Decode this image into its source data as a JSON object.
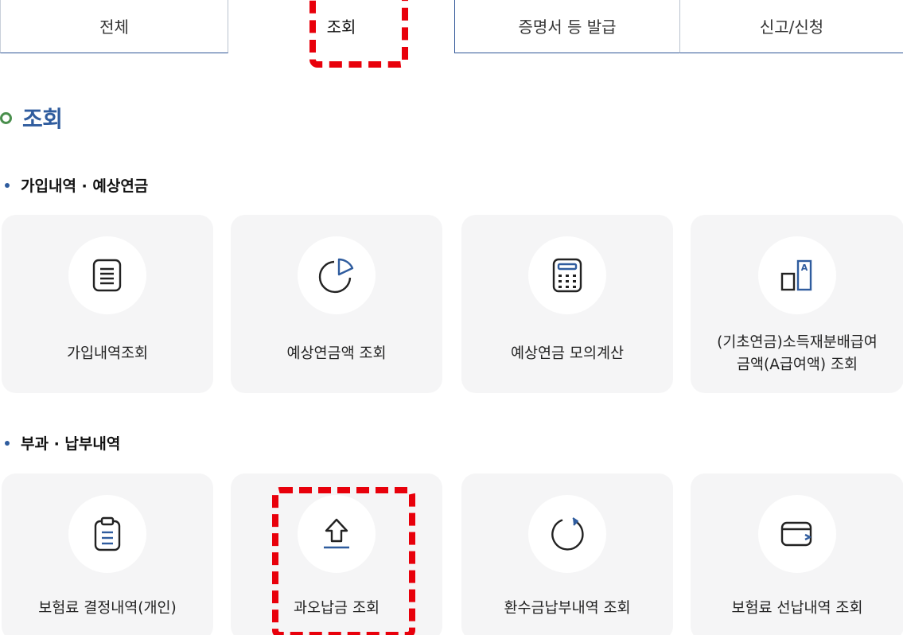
{
  "tabs": [
    {
      "label": "전체"
    },
    {
      "label": "조회",
      "active": true
    },
    {
      "label": "증명서 등 발급"
    },
    {
      "label": "신고/신청"
    }
  ],
  "section": {
    "title": "조회"
  },
  "groups": [
    {
      "title": "가입내역 · 예상연금",
      "cards": [
        {
          "label": "가입내역조회",
          "icon": "document-list-icon"
        },
        {
          "label": "예상연금액 조회",
          "icon": "pie-chart-icon"
        },
        {
          "label": "예상연금 모의계산",
          "icon": "calculator-icon"
        },
        {
          "label_line1": "(기초연금)소득재분배급여",
          "label_line2": "금액(A급여액) 조회",
          "icon": "bar-a-icon"
        }
      ]
    },
    {
      "title": "부과 · 납부내역",
      "cards": [
        {
          "label": "보험료 결정내역(개인)",
          "icon": "clipboard-icon"
        },
        {
          "label": "과오납금 조회",
          "icon": "upload-arrow-icon"
        },
        {
          "label": "환수금납부내역 조회",
          "icon": "refresh-icon"
        },
        {
          "label": "보험료 선납내역 조회",
          "icon": "wallet-icon"
        }
      ]
    }
  ],
  "colors": {
    "accent": "#2f5c9e",
    "highlight": "#e8000b",
    "ring": "#4a8f4d",
    "card_bg": "#f5f5f6"
  }
}
